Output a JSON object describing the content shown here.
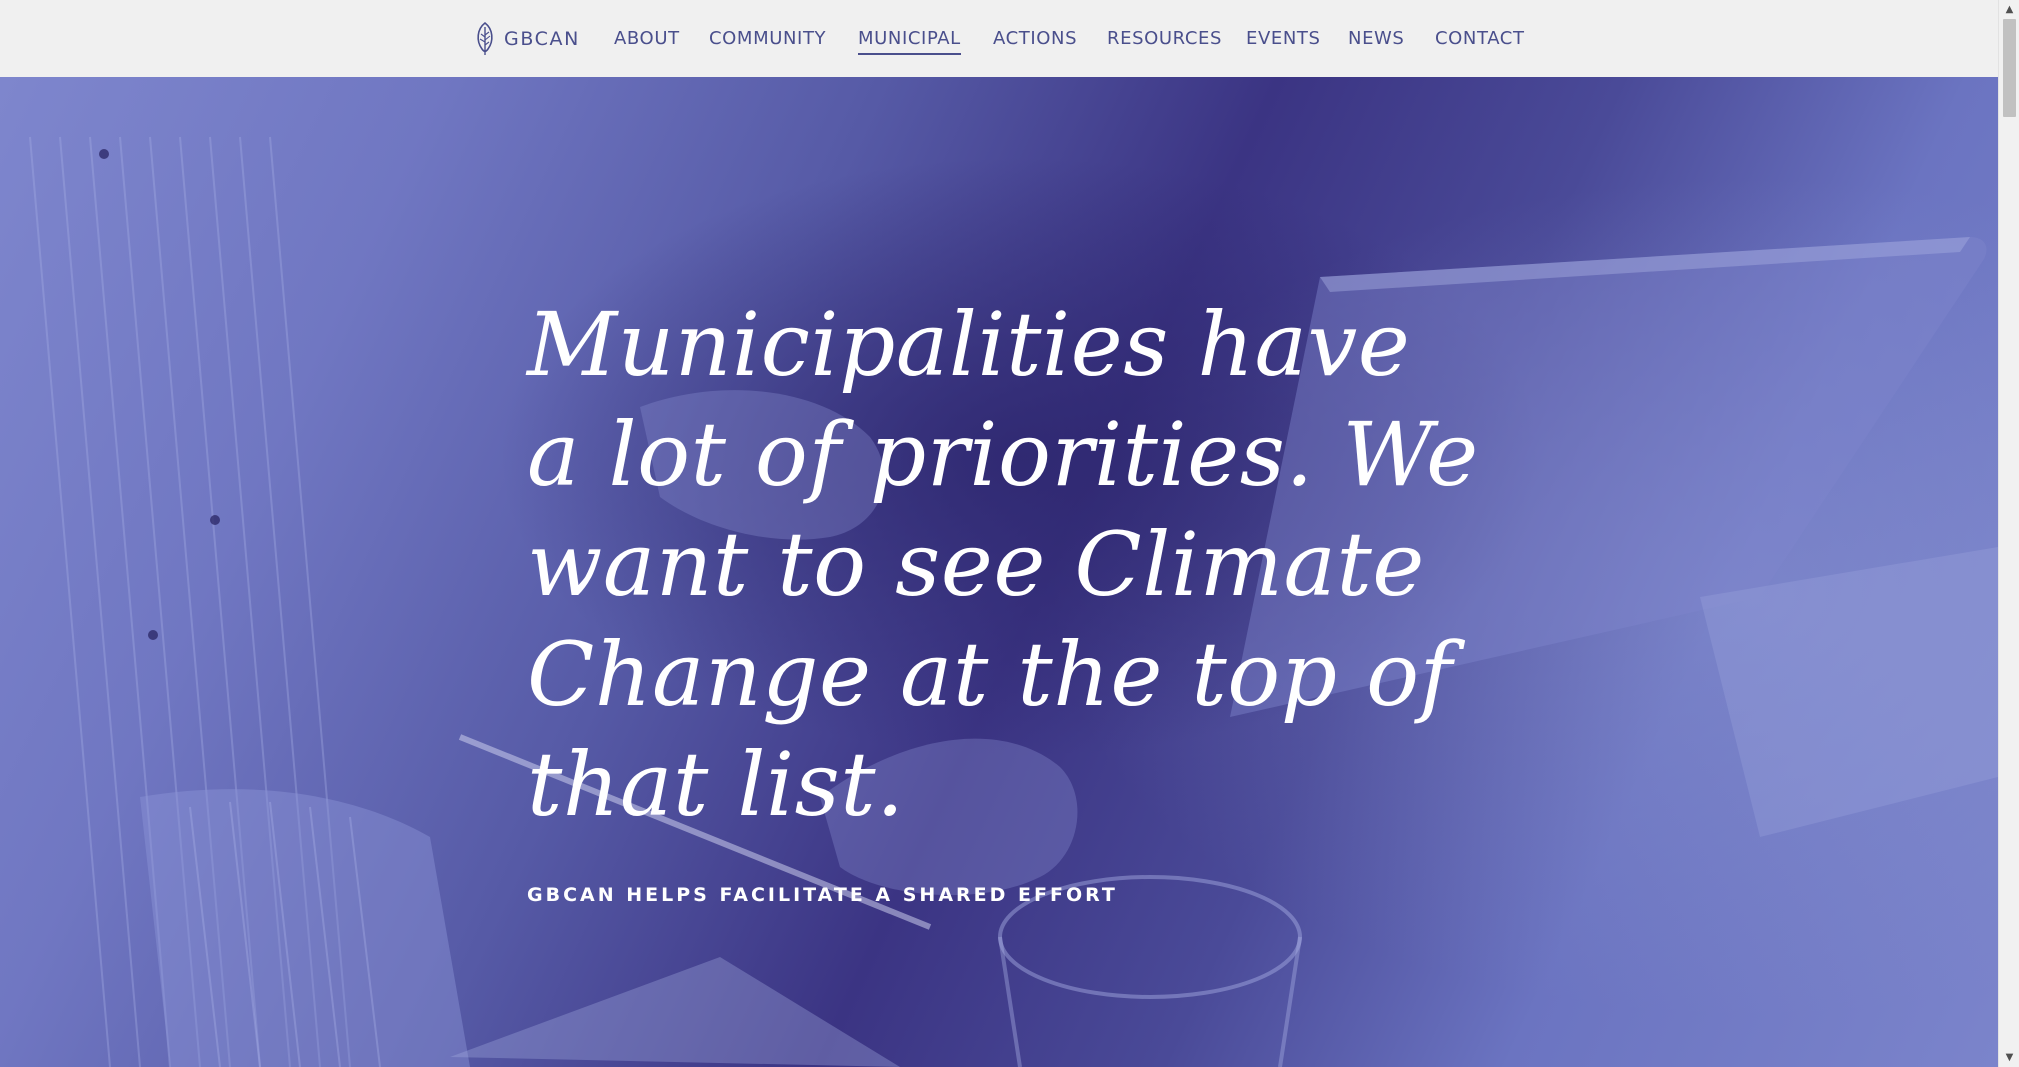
{
  "brand": {
    "name": "GBCAN",
    "logo_icon": "leaf-icon"
  },
  "nav": {
    "items": [
      {
        "label": "ABOUT"
      },
      {
        "label": "COMMUNITY"
      },
      {
        "label": "MUNICIPAL",
        "active": true
      },
      {
        "label": "ACTIONS"
      },
      {
        "label": "RESOURCES"
      },
      {
        "label": "EVENTS"
      },
      {
        "label": "NEWS"
      },
      {
        "label": "CONTACT"
      }
    ]
  },
  "hero": {
    "headline": "Municipalities have a lot of priorities. We want to see Climate Change at the top of that list.",
    "subheadline": "GBCAN HELPS FACILITATE A SHARED EFFORT"
  },
  "colors": {
    "nav_background": "#f0f0f0",
    "nav_text": "#4a4f8c",
    "hero_tint": "#5a5fb0",
    "hero_text": "#ffffff"
  },
  "scrollbar": {
    "up_icon": "scroll-up-arrow-icon",
    "down_icon": "scroll-down-arrow-icon"
  }
}
